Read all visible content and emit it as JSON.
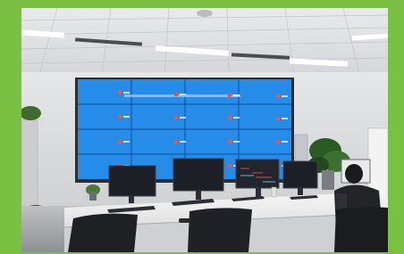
{
  "photo": {
    "border_color": "#7ac043",
    "wall_color": "#e4e5e6",
    "screen_color": "#1f86e6",
    "desk_color": "#f1f1f1",
    "monitor_color": "#1c1f26",
    "screen_grid": {
      "rows": 4,
      "cols": 4
    },
    "screen_logo_color": "#e8554f"
  }
}
